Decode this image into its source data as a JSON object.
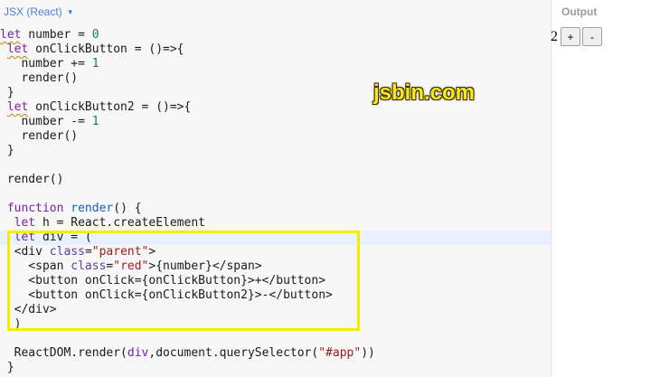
{
  "editor": {
    "panel_label": "JSX (React)",
    "lines": [
      [
        {
          "t": "let",
          "c": "kw",
          "sq": true
        },
        {
          "t": " number = ",
          "c": "var"
        },
        {
          "t": "0",
          "c": "num"
        }
      ],
      [
        {
          "t": " "
        },
        {
          "t": "let",
          "c": "kw",
          "sq": true
        },
        {
          "t": " onClickButton = ()=>{",
          "c": "var"
        }
      ],
      [
        {
          "t": "   number += ",
          "c": "var"
        },
        {
          "t": "1",
          "c": "num"
        }
      ],
      [
        {
          "t": "   render()",
          "c": "var"
        }
      ],
      [
        {
          "t": " }",
          "c": "var"
        }
      ],
      [
        {
          "t": " "
        },
        {
          "t": "let",
          "c": "kw",
          "sq": true
        },
        {
          "t": " onClickButton2 = ()=>{",
          "c": "var"
        }
      ],
      [
        {
          "t": "   number -= ",
          "c": "var"
        },
        {
          "t": "1",
          "c": "num"
        }
      ],
      [
        {
          "t": "   render()",
          "c": "var"
        }
      ],
      [
        {
          "t": " }",
          "c": "var"
        }
      ],
      [],
      [
        {
          "t": " render()",
          "c": "var"
        }
      ],
      [],
      [
        {
          "t": " "
        },
        {
          "t": "function",
          "c": "kw"
        },
        {
          "t": " "
        },
        {
          "t": "render",
          "c": "fn"
        },
        {
          "t": "() {",
          "c": "var"
        }
      ],
      [
        {
          "t": "  "
        },
        {
          "t": "let",
          "c": "kw"
        },
        {
          "t": " h = React.createElement",
          "c": "var"
        }
      ],
      [
        {
          "t": "  "
        },
        {
          "t": "let",
          "c": "kw"
        },
        {
          "t": " div = (",
          "c": "var"
        }
      ],
      [
        {
          "t": "  <div ",
          "c": "tag"
        },
        {
          "t": "class",
          "c": "attr"
        },
        {
          "t": "=",
          "c": "var"
        },
        {
          "t": "\"parent\"",
          "c": "str"
        },
        {
          "t": ">",
          "c": "tag"
        }
      ],
      [
        {
          "t": "    <span ",
          "c": "tag"
        },
        {
          "t": "class",
          "c": "attr"
        },
        {
          "t": "=",
          "c": "var"
        },
        {
          "t": "\"red\"",
          "c": "str"
        },
        {
          "t": ">{number}</span>",
          "c": "tag"
        }
      ],
      [
        {
          "t": "    <button onClick={onClickButton}>+</button>",
          "c": "tag"
        }
      ],
      [
        {
          "t": "    <button onClick={onClickButton2}>-</button>",
          "c": "tag"
        }
      ],
      [
        {
          "t": "  </div>",
          "c": "tag"
        }
      ],
      [
        {
          "t": "  )",
          "c": "var"
        }
      ],
      [],
      [
        {
          "t": "  ReactDOM.render(",
          "c": "var"
        },
        {
          "t": "div",
          "c": "kw"
        },
        {
          "t": ",document.querySelector(",
          "c": "var"
        },
        {
          "t": "\"#app\"",
          "c": "str"
        },
        {
          "t": "))",
          "c": "var"
        }
      ],
      [
        {
          "t": " }",
          "c": "var"
        }
      ]
    ]
  },
  "watermark": "jsbin.com",
  "output": {
    "label": "Output",
    "number": "2",
    "plus_label": "+",
    "minus_label": "-"
  }
}
